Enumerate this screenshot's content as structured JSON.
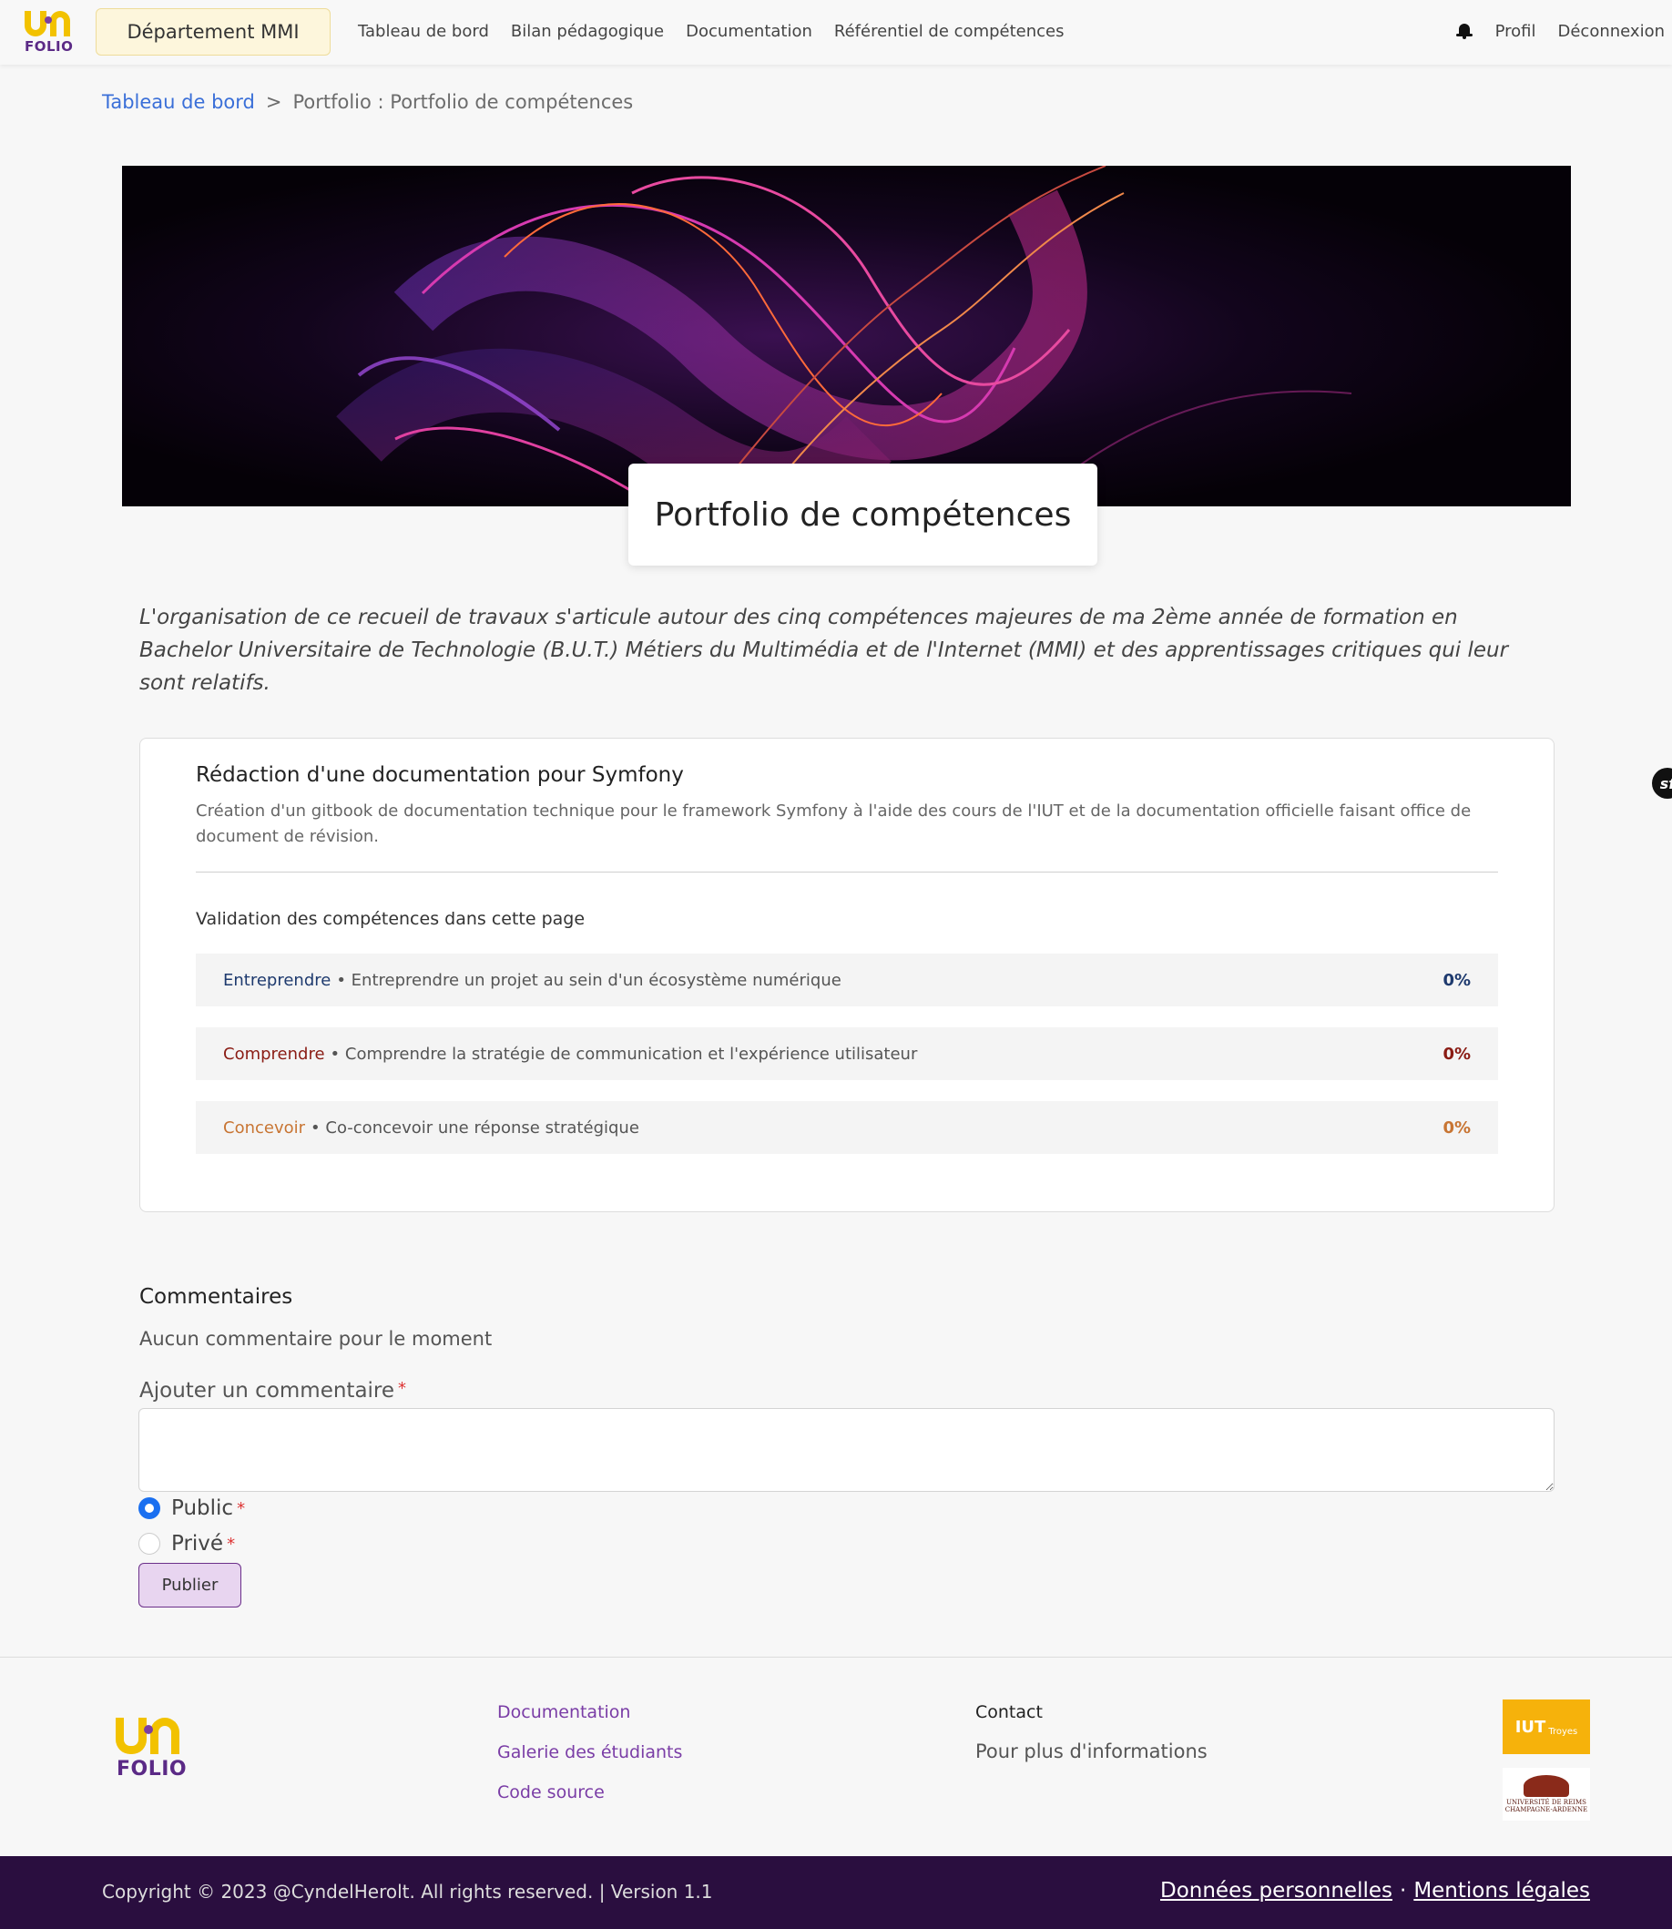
{
  "nav": {
    "logo_text": "FOLIO",
    "logo_top": "UNI",
    "department": "Département MMI",
    "links": [
      "Tableau de bord",
      "Bilan pédagogique",
      "Documentation",
      "Référentiel de compétences"
    ],
    "profile": "Profil",
    "logout": "Déconnexion"
  },
  "breadcrumb": {
    "home": "Tableau de bord",
    "sep": ">",
    "current": "Portfolio : Portfolio de compétences"
  },
  "page": {
    "title": "Portfolio de compétences",
    "intro": "L'organisation de ce recueil de travaux s'articule autour des cinq compétences majeures de ma 2ème année de formation en Bachelor Universitaire de Technologie (B.U.T.) Métiers du Multimédia et de l'Internet (MMI) et des apprentissages critiques qui leur sont relatifs."
  },
  "project": {
    "title": "Rédaction d'une documentation pour Symfony",
    "description": "Création d'un gitbook de documentation technique pour le framework Symfony à l'aide des cours de l'IUT et de la documentation officielle faisant office de document de révision.",
    "validation_title": "Validation des compétences dans cette page",
    "competences": [
      {
        "name": "Entreprendre",
        "desc": "• Entreprendre un projet au sein d'un écosystème numérique",
        "pct": "0%",
        "color": "#1e3a6e"
      },
      {
        "name": "Comprendre",
        "desc": "• Comprendre la stratégie de communication et l'expérience utilisateur",
        "pct": "0%",
        "color": "#8a1c14"
      },
      {
        "name": "Concevoir",
        "desc": "• Co-concevoir une réponse stratégique",
        "pct": "0%",
        "color": "#c87533"
      }
    ]
  },
  "comments": {
    "title": "Commentaires",
    "empty": "Aucun commentaire pour le moment",
    "add_label": "Ajouter un commentaire",
    "required_mark": "*",
    "textarea_value": "",
    "visibility": [
      {
        "label": "Public",
        "checked": true
      },
      {
        "label": "Privé",
        "checked": false
      }
    ],
    "publish": "Publier"
  },
  "footer": {
    "links": [
      "Documentation",
      "Galerie des étudiants",
      "Code source"
    ],
    "contact_title": "Contact",
    "contact_text": "Pour plus d'informations",
    "iut_logo": "IUT",
    "iut_logo_sub": "Troyes",
    "urca_logo": "UNIVERSITÉ DE REIMS CHAMPAGNE-ARDENNE",
    "copyright": "Copyright © 2023 @CyndelHerolt. All rights reserved. | Version 1.1",
    "privacy": "Données personnelles",
    "dot": "·",
    "legal": "Mentions légales"
  },
  "colors": {
    "accent": "#7a3da6",
    "brand_yellow": "#f2c200",
    "footer_bar": "#2a0e3f",
    "radio_blue": "#1a6ff0"
  },
  "icons": [
    "bell-icon",
    "symfony-icon"
  ]
}
